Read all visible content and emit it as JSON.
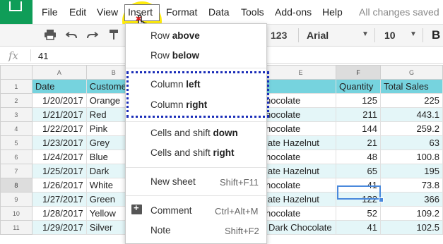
{
  "menubar": {
    "items": [
      "File",
      "Edit",
      "View",
      "Insert",
      "Format",
      "Data",
      "Tools",
      "Add-ons",
      "Help"
    ],
    "status": "All changes saved"
  },
  "toolbar": {
    "number_format": "123",
    "font": "Arial",
    "font_size": "10",
    "bold": "B",
    "icons": [
      "print-icon",
      "undo-icon",
      "redo-icon",
      "paint-format-icon"
    ]
  },
  "formula_bar": {
    "fx": "fx",
    "value": "41"
  },
  "sheet": {
    "columns": [
      "A",
      "B",
      "C",
      "D",
      "E",
      "F",
      "G"
    ],
    "row_numbers": [
      "1",
      "2",
      "3",
      "4",
      "5",
      "6",
      "7",
      "8",
      "9",
      "10",
      "11"
    ],
    "header": [
      "Date",
      "Custome",
      "",
      "",
      "t",
      "Quantity",
      "Total Sales"
    ],
    "rows": [
      [
        "1/20/2017",
        "Orange",
        "",
        "",
        "hocolate",
        "125",
        "225"
      ],
      [
        "1/21/2017",
        "Red",
        "",
        "",
        "hocolate",
        "211",
        "443.1"
      ],
      [
        "1/22/2017",
        "Pink",
        "",
        "",
        "hocolate",
        "144",
        "259.2"
      ],
      [
        "1/23/2017",
        "Grey",
        "",
        "",
        "late Hazelnut",
        "21",
        "63"
      ],
      [
        "1/24/2017",
        "Blue",
        "",
        "",
        "hocolate",
        "48",
        "100.8"
      ],
      [
        "1/25/2017",
        "Dark",
        "",
        "",
        "late Hazelnut",
        "65",
        "195"
      ],
      [
        "1/26/2017",
        "White",
        "",
        "",
        "hocolate",
        "41",
        "73.8"
      ],
      [
        "1/27/2017",
        "Green",
        "",
        "",
        "late Hazelnut",
        "122",
        "366"
      ],
      [
        "1/28/2017",
        "Yellow",
        "",
        "",
        "hocolate",
        "52",
        "109.2"
      ],
      [
        "1/29/2017",
        "Silver",
        "",
        "",
        "Dark Chocolate",
        "41",
        "102.5"
      ]
    ]
  },
  "insert_menu": {
    "row_above": {
      "pre": "Row ",
      "bold": "above"
    },
    "row_below": {
      "pre": "Row ",
      "bold": "below"
    },
    "column_left": {
      "pre": "Column ",
      "bold": "left"
    },
    "column_right": {
      "pre": "Column ",
      "bold": "right"
    },
    "cells_down": {
      "pre": "Cells and shift ",
      "bold": "down"
    },
    "cells_right": {
      "pre": "Cells and shift ",
      "bold": "right"
    },
    "new_sheet": {
      "label": "New sheet",
      "shortcut": "Shift+F11"
    },
    "comment": {
      "label": "Comment",
      "shortcut": "Ctrl+Alt+M"
    },
    "note": {
      "label": "Note",
      "shortcut": "Shift+F2"
    }
  },
  "colors": {
    "brand": "#0f9d58",
    "header_fill": "#76d3de",
    "band_fill": "#e4f6f8",
    "highlight": "#ffeb00",
    "dotted_box": "#1a2db8",
    "active_cell": "#4a89dc"
  }
}
